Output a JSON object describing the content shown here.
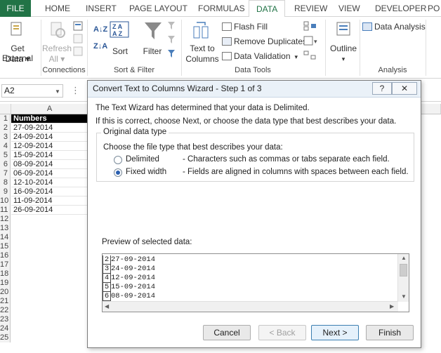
{
  "ribbon_tabs": [
    "FILE",
    "HOME",
    "INSERT",
    "PAGE LAYOUT",
    "FORMULAS",
    "DATA",
    "REVIEW",
    "VIEW",
    "DEVELOPER",
    "PO"
  ],
  "active_tab": "DATA",
  "colors": {
    "accent": "#217346",
    "header_cell": "#000000"
  },
  "ribbon": {
    "get_external_data": {
      "line1": "Get External",
      "line2": "Data ▾"
    },
    "refresh_all": {
      "line1": "Refresh",
      "line2": "All ▾"
    },
    "connections_label": "Connections",
    "sort_label": "Sort",
    "filter_label": "Filter",
    "sort_filter_label": "Sort & Filter",
    "text_to_columns": {
      "line1": "Text to",
      "line2": "Columns"
    },
    "flash_fill": "Flash Fill",
    "remove_duplicates": "Remove Duplicates",
    "data_validation": "Data Validation",
    "data_tools_label": "Data Tools",
    "outline": "Outline",
    "data_analysis": "Data Analysis",
    "analysis_label": "Analysis"
  },
  "formula_bar": {
    "name_box": "A2",
    "dots": "⋮"
  },
  "sheet": {
    "column_header": "A",
    "header_value": "Numbers",
    "rows": [
      "27-09-2014",
      "24-09-2014",
      "12-09-2014",
      "15-09-2014",
      "08-09-2014",
      "06-09-2014",
      "12-10-2014",
      "16-09-2014",
      "11-09-2014",
      "26-09-2014"
    ],
    "row_numbers": [
      "1",
      "2",
      "3",
      "4",
      "5",
      "6",
      "7",
      "8",
      "9",
      "10",
      "11",
      "12",
      "13",
      "14",
      "15",
      "16",
      "17",
      "18",
      "19",
      "20",
      "21",
      "22",
      "23",
      "24",
      "25"
    ]
  },
  "dialog": {
    "title": "Convert Text to Columns Wizard - Step 1 of 3",
    "help_button": "?",
    "close_button": "✕",
    "intro_line": "The Text Wizard has determined that your data is Delimited.",
    "intro_line2": "If this is correct, choose Next, or choose the data type that best describes your data.",
    "original_data_type": "Original data type",
    "choose_label": "Choose the file type that best describes your data:",
    "options": [
      {
        "label": "Delimited",
        "description": "- Characters such as commas or tabs separate each field.",
        "selected": false
      },
      {
        "label": "Fixed width",
        "description": "- Fields are aligned in columns with spaces between each field.",
        "selected": true
      }
    ],
    "preview_label": "Preview of selected data:",
    "preview_rows": [
      {
        "num": "2",
        "text": "27-09-2014"
      },
      {
        "num": "3",
        "text": "24-09-2014"
      },
      {
        "num": "4",
        "text": "12-09-2014"
      },
      {
        "num": "5",
        "text": "15-09-2014"
      },
      {
        "num": "6",
        "text": "08-09-2014"
      }
    ],
    "buttons": {
      "cancel": "Cancel",
      "back": "< Back",
      "next": "Next >",
      "finish": "Finish"
    }
  }
}
